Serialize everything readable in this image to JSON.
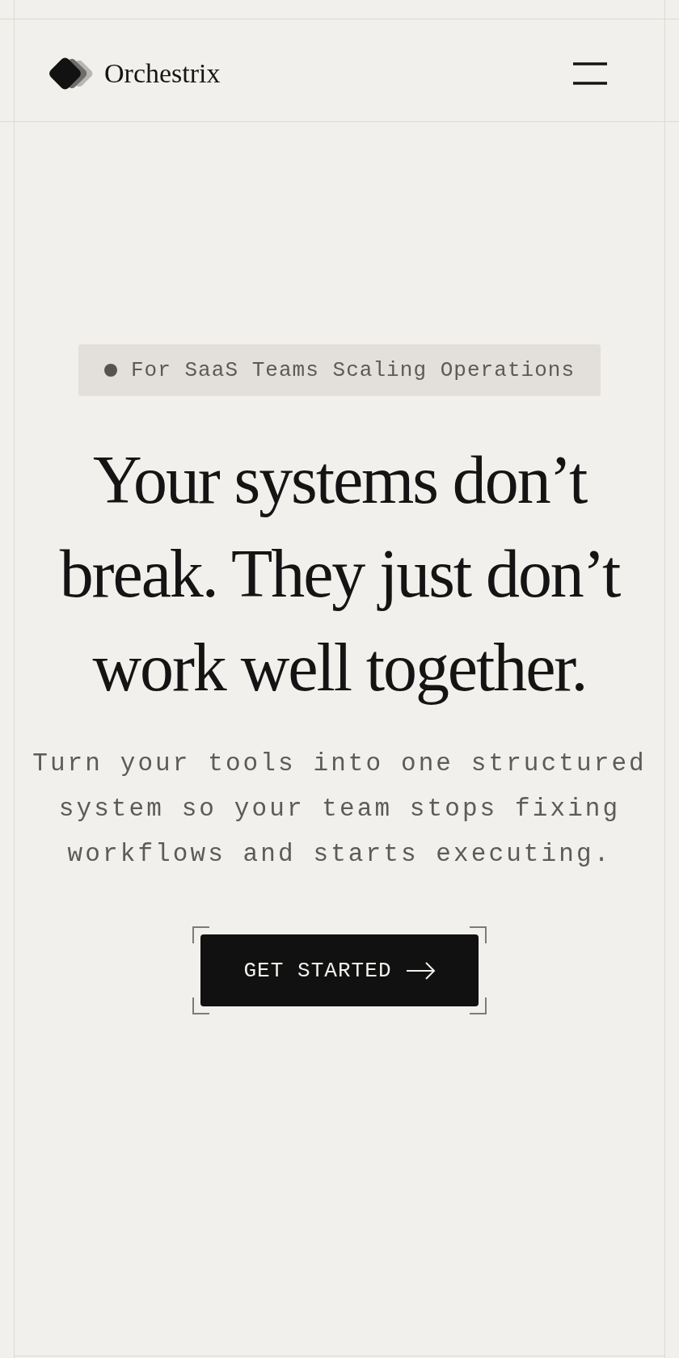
{
  "header": {
    "logo_text": "Orchestrix"
  },
  "badge": {
    "text": "For SaaS Teams Scaling Operations"
  },
  "hero": {
    "headline": "Your systems don’t break. They just don’t work well together.",
    "subheadline": "Turn your tools into one structured system so your team stops fixing workflows and starts executing.",
    "cta": {
      "label": "GET STARTED"
    }
  }
}
